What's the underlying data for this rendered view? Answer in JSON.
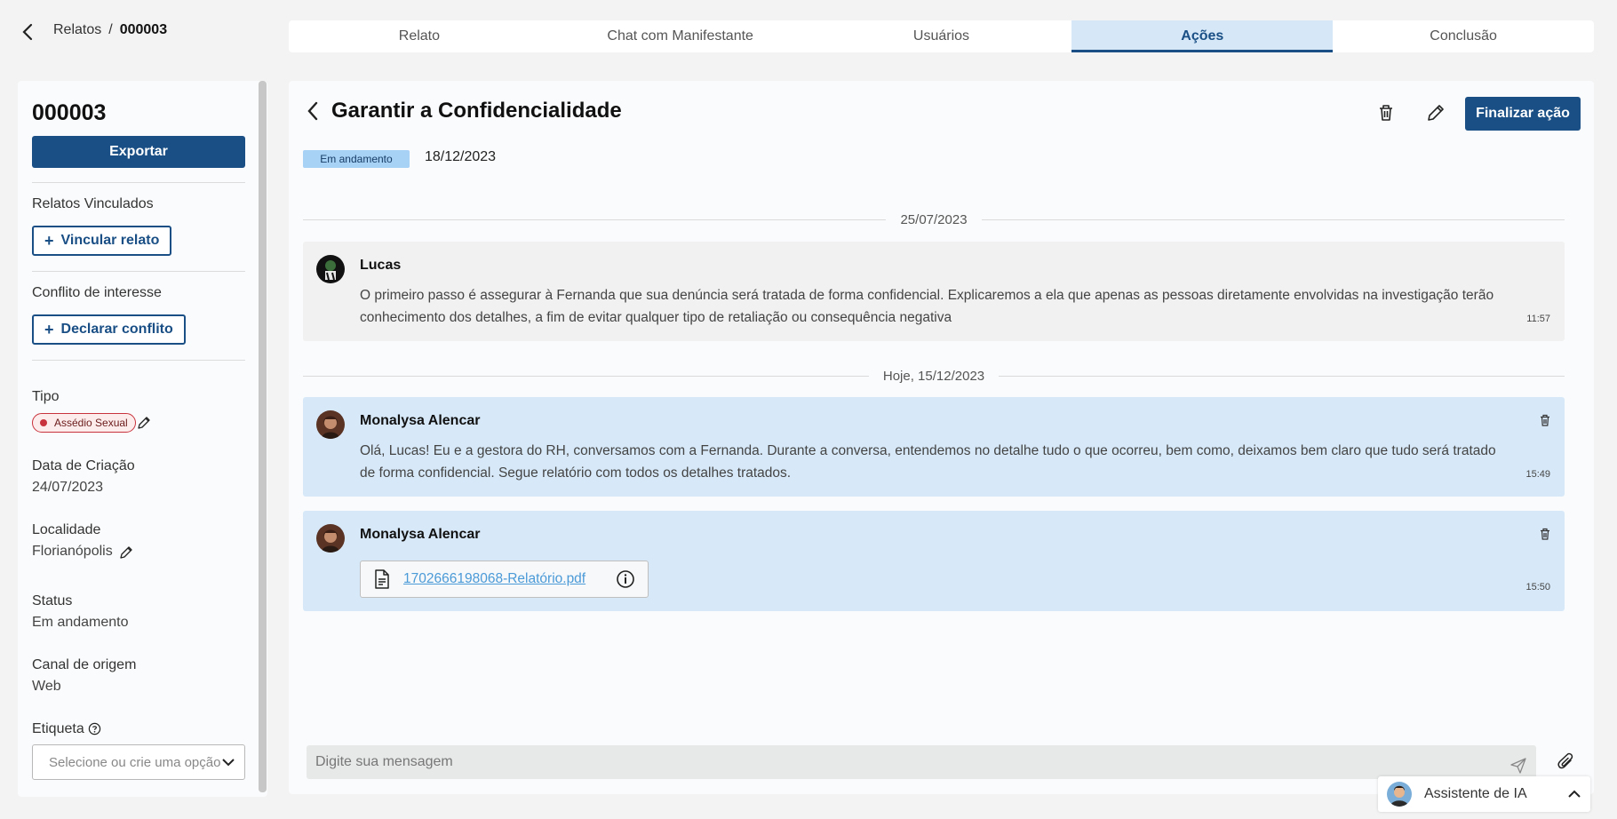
{
  "breadcrumb": {
    "parent": "Relatos",
    "separator": "/",
    "current": "000003"
  },
  "tabs": [
    {
      "label": "Relato",
      "active": false
    },
    {
      "label": "Chat com Manifestante",
      "active": false
    },
    {
      "label": "Usuários",
      "active": false
    },
    {
      "label": "Ações",
      "active": true
    },
    {
      "label": "Conclusão",
      "active": false
    }
  ],
  "sidebar": {
    "code": "000003",
    "export_label": "Exportar",
    "linked_reports_label": "Relatos Vinculados",
    "link_button": "Vincular relato",
    "conflict_label": "Conflito de interesse",
    "conflict_button": "Declarar conflito",
    "type_label": "Tipo",
    "type_value": "Assédio Sexual",
    "created_label": "Data de Criação",
    "created_value": "24/07/2023",
    "location_label": "Localidade",
    "location_value": "Florianópolis",
    "status_label": "Status",
    "status_value": "Em andamento",
    "channel_label": "Canal de origem",
    "channel_value": "Web",
    "tag_label": "Etiqueta",
    "tag_placeholder": "Selecione ou crie uma opção"
  },
  "action": {
    "title": "Garantir a Confidencialidade",
    "finalize_label": "Finalizar ação",
    "status_badge": "Em andamento",
    "date": "18/12/2023"
  },
  "timeline": {
    "separator_1": "25/07/2023",
    "separator_2": "Hoje, 15/12/2023",
    "messages": [
      {
        "author": "Lucas",
        "text": "O primeiro passo é assegurar à Fernanda que sua denúncia será tratada de forma confidencial. Explicaremos a ela que apenas as pessoas diretamente envolvidas na investigação terão conhecimento dos detalhes, a fim de evitar qualquer tipo de retaliação ou consequência negativa",
        "time": "11:57"
      },
      {
        "author": "Monalysa Alencar",
        "text": "Olá, Lucas! Eu e a gestora do RH, conversamos com a Fernanda. Durante a conversa, entendemos no detalhe tudo o que ocorreu, bem como, deixamos bem claro que tudo será tratado de forma confidencial. Segue relatório com todos os detalhes tratados.",
        "time": "15:49"
      },
      {
        "author": "Monalysa Alencar",
        "attachment": "1702666198068-Relatório.pdf",
        "time": "15:50"
      }
    ]
  },
  "composer": {
    "placeholder": "Digite sua mensagem"
  },
  "assistant": {
    "label": "Assistente de IA"
  },
  "colors": {
    "primary": "#1a4f85",
    "active_tab_bg": "#d6e8f8",
    "badge_bg": "#a7d1f5",
    "tag_red": "#c8323c",
    "link": "#4a9ad8"
  }
}
